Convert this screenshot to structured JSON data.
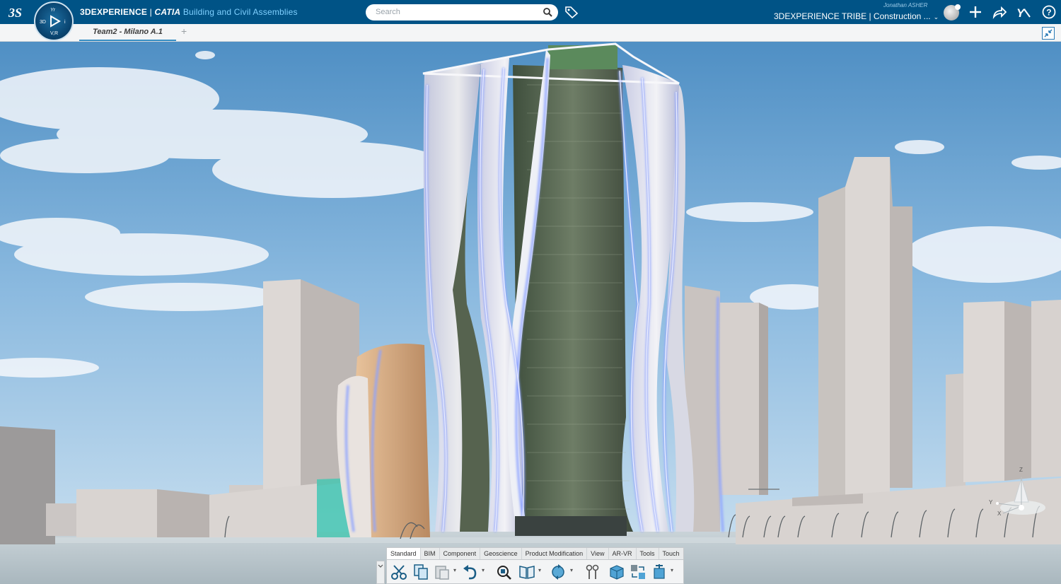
{
  "topbar": {
    "brand": "3DEXPERIENCE",
    "separator": " | ",
    "app": "CATIA",
    "role": " Building and Civil Assemblies",
    "search_placeholder": "Search",
    "user": "Jonathan ASHER",
    "tenant": "3DEXPERIENCE TRIBE | Construction ...",
    "compass_labels": {
      "top": "Yr",
      "left": "3D",
      "right": "i",
      "bottom": "V,R"
    }
  },
  "tabs": [
    {
      "label": "Team2 - Milano A.1"
    }
  ],
  "tab_add": "+",
  "action_bar": {
    "tabs": [
      "Standard",
      "BIM",
      "Component",
      "Geoscience",
      "Product Modification",
      "View",
      "AR-VR",
      "Tools",
      "Touch"
    ]
  },
  "compass3d": {
    "z": "Z",
    "y": "Y",
    "x": "X"
  },
  "colors": {
    "topbar": "#005386",
    "accent": "#368ec4",
    "sky": "#9fc7e6"
  }
}
